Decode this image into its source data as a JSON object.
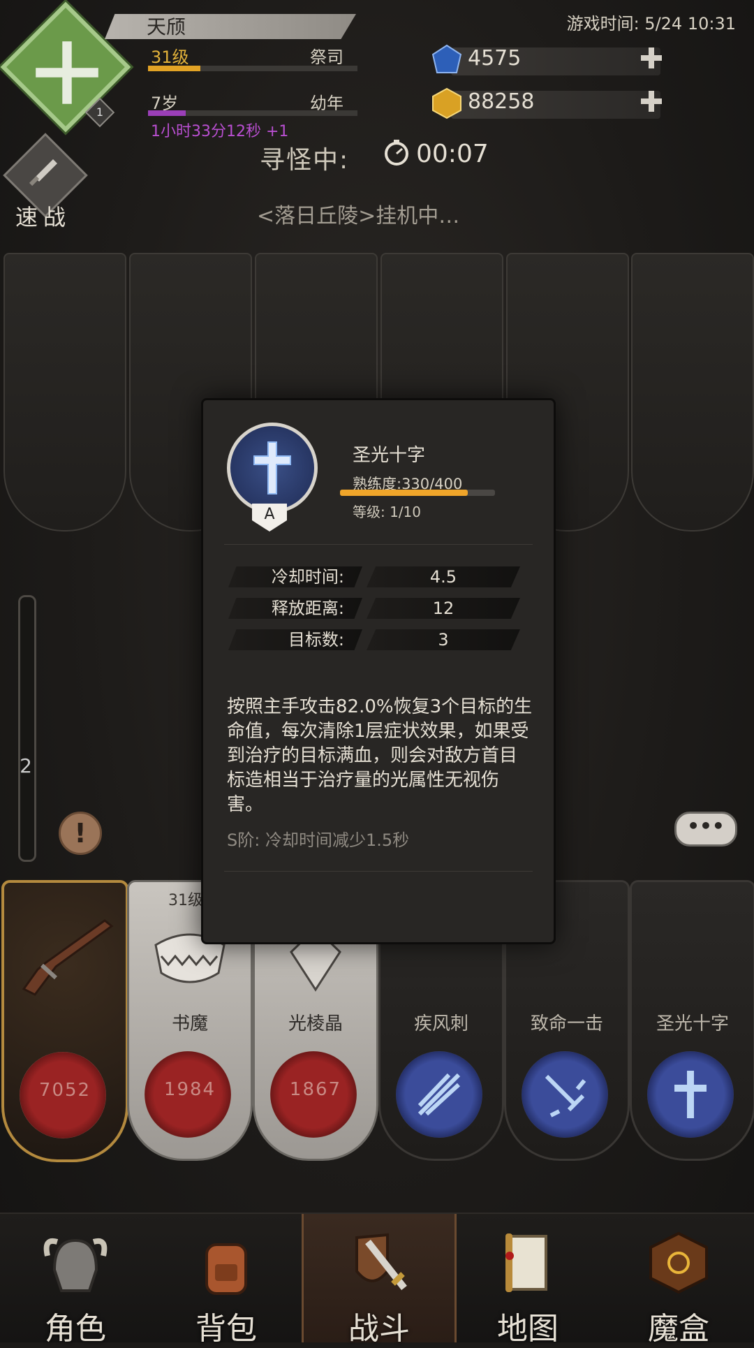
{
  "player": {
    "name": "天颀",
    "level_label": "31级",
    "job": "祭司",
    "level_progress": 0.25,
    "age": "7岁",
    "stage": "幼年",
    "age_progress": 0.18,
    "timer": "1小时33分12秒 +1",
    "crest_badge": "1"
  },
  "game_time": "游戏时间: 5/24 10:31",
  "currencies": [
    {
      "icon": "blue-gem-icon",
      "value": "4575"
    },
    {
      "icon": "gold-gem-icon",
      "value": "88258"
    }
  ],
  "search": {
    "label": "寻怪中:",
    "time": "00:07"
  },
  "quick_battle": {
    "label": "速战"
  },
  "idle": "<落日丘陵>挂机中…",
  "side": {
    "stack_num": "2",
    "alert": "!",
    "chat": "•••"
  },
  "cards": [
    {
      "name": "",
      "value": "7052",
      "style": "gold",
      "icon": "musket-icon"
    },
    {
      "name": "书魔",
      "value": "1984",
      "style": "light",
      "icon": "book-demon-icon",
      "level": "31级"
    },
    {
      "name": "光棱晶",
      "value": "1867",
      "style": "light",
      "icon": "prism-crystal-icon"
    },
    {
      "name": "疾风刺",
      "value": "",
      "style": "dark",
      "icon": "wind-thrust-icon"
    },
    {
      "name": "致命一击",
      "value": "",
      "style": "dark",
      "icon": "fatal-strike-icon"
    },
    {
      "name": "圣光十字",
      "value": "",
      "style": "dark",
      "icon": "holy-cross-icon"
    }
  ],
  "popup": {
    "skill_name": "圣光十字",
    "proficiency": "熟练度:330/400",
    "proficiency_ratio": 0.825,
    "level": "等级: 1/10",
    "grade": "A",
    "stats": [
      {
        "label": "冷却时间:",
        "value": "4.5"
      },
      {
        "label": "释放距离:",
        "value": "12"
      },
      {
        "label": "目标数:",
        "value": "3"
      }
    ],
    "description": "按照主手攻击82.0%恢复3个目标的生命值，每次清除1层症状效果，如果受到治疗的目标满血，则会对敌方首目标造相当于治疗量的光属性无视伤害。",
    "upgrade": "S阶: 冷却时间减少1.5秒"
  },
  "nav": [
    {
      "label": "角色",
      "icon": "helmet-icon"
    },
    {
      "label": "背包",
      "icon": "backpack-icon"
    },
    {
      "label": "战斗",
      "icon": "sword-shield-icon",
      "active": true
    },
    {
      "label": "地图",
      "icon": "scroll-map-icon"
    },
    {
      "label": "魔盒",
      "icon": "magic-box-icon"
    }
  ]
}
